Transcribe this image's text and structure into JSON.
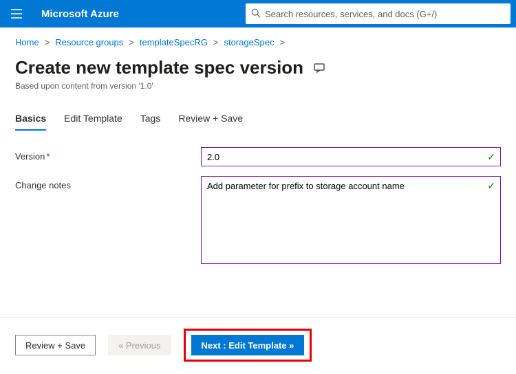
{
  "header": {
    "brand": "Microsoft Azure",
    "search_placeholder": "Search resources, services, and docs (G+/)"
  },
  "breadcrumb": {
    "items": [
      {
        "label": "Home"
      },
      {
        "label": "Resource groups"
      },
      {
        "label": "templateSpecRG"
      },
      {
        "label": "storageSpec"
      }
    ]
  },
  "page": {
    "title": "Create new template spec version",
    "subtitle": "Based upon content from version '1.0'"
  },
  "tabs": [
    {
      "label": "Basics",
      "active": true
    },
    {
      "label": "Edit Template",
      "active": false
    },
    {
      "label": "Tags",
      "active": false
    },
    {
      "label": "Review + Save",
      "active": false
    }
  ],
  "form": {
    "version_label": "Version",
    "version_value": "2.0",
    "notes_label": "Change notes",
    "notes_value": "Add parameter for prefix to storage account name"
  },
  "footer": {
    "review_label": "Review + Save",
    "prev_label": "« Previous",
    "next_label": "Next : Edit Template »"
  }
}
